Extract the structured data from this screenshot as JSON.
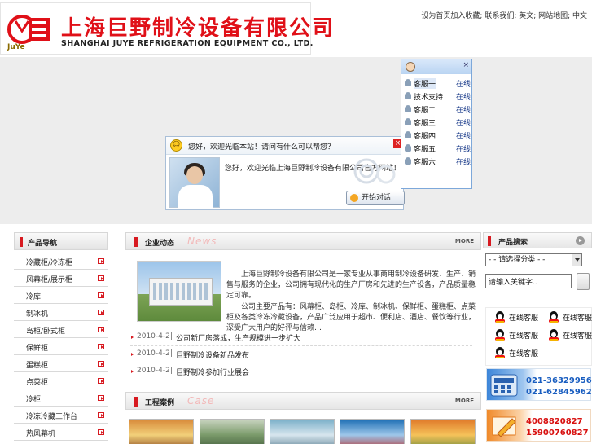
{
  "header": {
    "logo_mark_text": "JY巨野",
    "logo_cn": "上海巨野制冷设备有限公司",
    "logo_en": "SHANGHAI JUYE REFRIGERATION EQUIPMENT CO., LTD.",
    "links": "设为首页加入收藏; 联系我们; 英文; 网站地图; 中文"
  },
  "chat_popup": {
    "title": "您好，欢迎光临本站！请问有什么可以帮您？",
    "message": "您好，欢迎光临上海巨野制冷设备有限公司官方网站！",
    "start_label": "开始对话",
    "close": "×"
  },
  "service_panel": {
    "close": "×",
    "staff": [
      {
        "name": "客服一",
        "status": "在线"
      },
      {
        "name": "技术支持",
        "status": "在线"
      },
      {
        "name": "客服二",
        "status": "在线"
      },
      {
        "name": "客服三",
        "status": "在线"
      },
      {
        "name": "客服四",
        "status": "在线"
      },
      {
        "name": "客服五",
        "status": "在线"
      },
      {
        "name": "客服六",
        "status": "在线"
      }
    ]
  },
  "left_nav": {
    "title": "产品导航",
    "items": [
      "冷藏柜/冷冻柜",
      "风幕柜/展示柜",
      "冷库",
      "制冰机",
      "岛柜/卧式柜",
      "保鲜柜",
      "蛋糕柜",
      "点菜柜",
      "冷柜",
      "冷冻冷藏工作台",
      "热风幕机"
    ]
  },
  "news": {
    "title": "企业动态",
    "title_en": "News",
    "more": "MORE",
    "intro_1": "上海巨野制冷设备有限公司是一家专业从事商用制冷设备研发、生产、销售与服务的企业，公司拥有现代化的生产厂房和先进的生产设备，产品质量稳定可靠。",
    "intro_2": "公司主要产品有：风幕柜、岛柜、冷库、制冰机、保鲜柜、蛋糕柜、点菜柜及各类冷冻冷藏设备，产品广泛应用于超市、便利店、酒店、餐饮等行业，深受广大用户的好评与信赖…",
    "items": [
      {
        "date": "2010-4-2|",
        "title": "公司新厂房落成，生产规模进一步扩大"
      },
      {
        "date": "2010-4-2|",
        "title": "巨野制冷设备新品发布"
      },
      {
        "date": "2010-4-2|",
        "title": "巨野制冷参加行业展会"
      }
    ]
  },
  "cases": {
    "title": "工程案例",
    "title_en": "Case",
    "more": "MORE"
  },
  "product_search": {
    "title": "产品搜索",
    "select_value": "- - 请选择分类 - -",
    "input_value": "请输入关键字.."
  },
  "contact": {
    "qq": [
      "在线客服",
      "在线客服",
      "在线客服",
      "在线客服",
      "在线客服"
    ],
    "phones": [
      "021-36329956",
      "021-62845962"
    ],
    "hotlines": [
      "4008820827",
      "15900760827"
    ]
  },
  "colors": {
    "brand_red": "#e01018",
    "banner_bg": "#ededed",
    "link_blue": "#1a5ec0"
  }
}
